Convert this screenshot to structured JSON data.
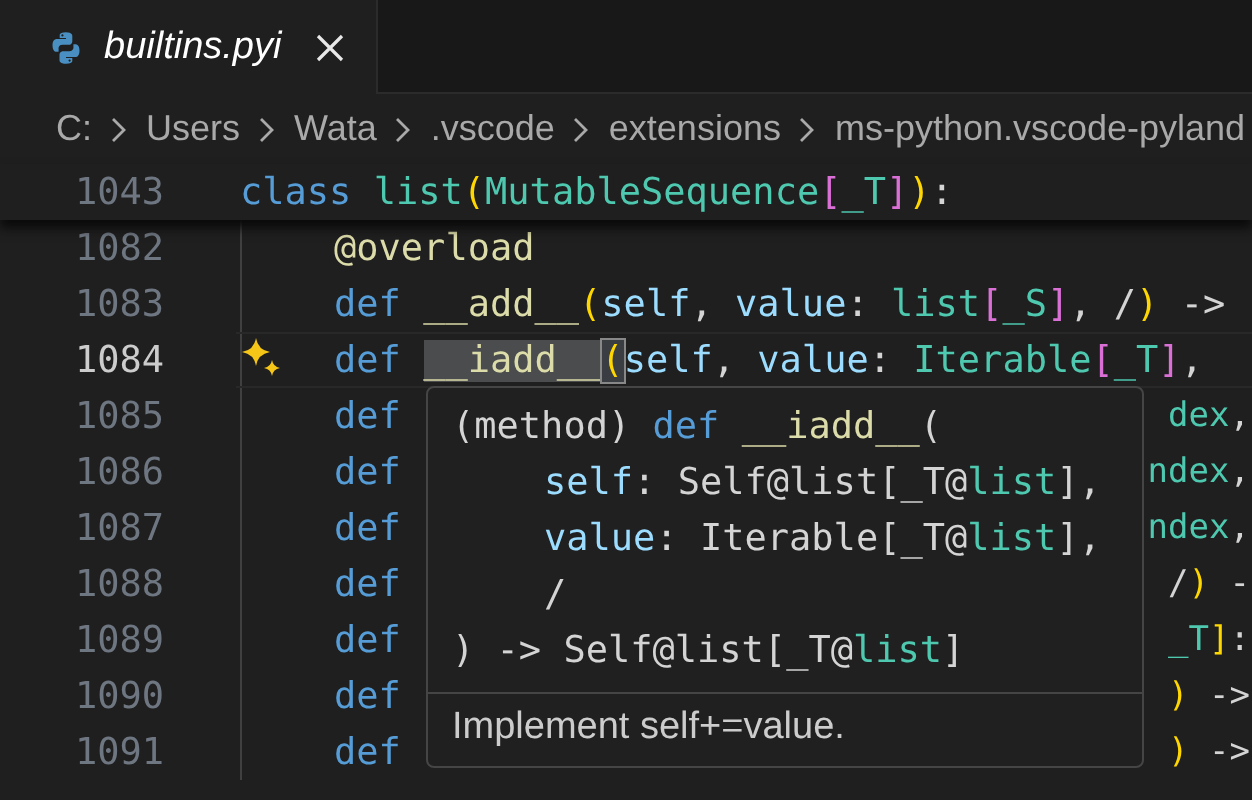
{
  "tab": {
    "title": "builtins.pyi",
    "preview": true
  },
  "breadcrumbs": [
    "C:",
    "Users",
    "Wata",
    ".vscode",
    "extensions",
    "ms-python.vscode-pyland"
  ],
  "sticky": {
    "number": "1043",
    "tokens": [
      {
        "t": "class ",
        "kind": "kw"
      },
      {
        "t": "list",
        "kind": "type"
      },
      {
        "t": "(",
        "kind": "br1"
      },
      {
        "t": "MutableSequence",
        "kind": "type"
      },
      {
        "t": "[",
        "kind": "br2"
      },
      {
        "t": "_T",
        "kind": "type"
      },
      {
        "t": "]",
        "kind": "br2"
      },
      {
        "t": ")",
        "kind": "br1"
      },
      {
        "t": ":",
        "kind": "plain"
      }
    ],
    "children": [
      {
        "number": "1082",
        "active": false,
        "tokens": [
          {
            "t": "@overload",
            "kind": "fn"
          }
        ]
      },
      {
        "number": "1083",
        "active": false,
        "tokens": [
          {
            "t": "def ",
            "kind": "kw"
          },
          {
            "t": "__add__",
            "kind": "fn"
          },
          {
            "t": "(",
            "kind": "br1"
          },
          {
            "t": "self",
            "kind": "param"
          },
          {
            "t": ", ",
            "kind": "plain"
          },
          {
            "t": "value",
            "kind": "param"
          },
          {
            "t": ": ",
            "kind": "plain"
          },
          {
            "t": "list",
            "kind": "type"
          },
          {
            "t": "[",
            "kind": "br2"
          },
          {
            "t": "_S",
            "kind": "type"
          },
          {
            "t": "]",
            "kind": "br2"
          },
          {
            "t": ", /",
            "kind": "plain"
          },
          {
            "t": ")",
            "kind": "br1"
          },
          {
            "t": " ->",
            "kind": "plain"
          }
        ]
      },
      {
        "number": "1084",
        "active": true,
        "tokens": [
          {
            "t": "def ",
            "kind": "kw"
          },
          {
            "t": "__iadd__",
            "kind": "fn_hl"
          },
          {
            "t": "(",
            "kind": "br1_match"
          },
          {
            "t": "self",
            "kind": "param"
          },
          {
            "t": ", ",
            "kind": "plain"
          },
          {
            "t": "value",
            "kind": "param"
          },
          {
            "t": ": ",
            "kind": "plain"
          },
          {
            "t": "Iterable",
            "kind": "type"
          },
          {
            "t": "[",
            "kind": "br2"
          },
          {
            "t": "_T",
            "kind": "type"
          },
          {
            "t": "]",
            "kind": "br2"
          },
          {
            "t": ",",
            "kind": "plain"
          }
        ]
      },
      {
        "number": "1085",
        "active": false,
        "tokens": [
          {
            "t": "def",
            "kind": "kw"
          }
        ],
        "tail": [
          {
            "t": "dex",
            "kind": "type"
          },
          {
            "t": ",",
            "kind": "plain"
          }
        ]
      },
      {
        "number": "1086",
        "active": false,
        "tokens": [
          {
            "t": "def",
            "kind": "kw"
          }
        ],
        "tail": [
          {
            "t": "ndex",
            "kind": "type"
          },
          {
            "t": ",",
            "kind": "plain"
          }
        ]
      },
      {
        "number": "1087",
        "active": false,
        "tokens": [
          {
            "t": "def",
            "kind": "kw"
          }
        ],
        "tail": [
          {
            "t": "ndex",
            "kind": "type"
          },
          {
            "t": ",",
            "kind": "plain"
          }
        ]
      },
      {
        "number": "1088",
        "active": false,
        "tokens": [
          {
            "t": "def",
            "kind": "kw"
          }
        ],
        "tail": [
          {
            "t": "/",
            "kind": "plain"
          },
          {
            "t": ")",
            "kind": "br1"
          },
          {
            "t": " -",
            "kind": "plain"
          }
        ]
      },
      {
        "number": "1089",
        "active": false,
        "tokens": [
          {
            "t": "def",
            "kind": "kw"
          }
        ],
        "tail": [
          {
            "t": "_T",
            "kind": "type"
          },
          {
            "t": "]",
            "kind": "br1"
          },
          {
            "t": ":",
            "kind": "plain"
          }
        ]
      },
      {
        "number": "1090",
        "active": false,
        "tokens": [
          {
            "t": "def",
            "kind": "kw"
          }
        ],
        "tail": [
          {
            "t": ")",
            "kind": "br1"
          },
          {
            "t": " ->",
            "kind": "plain"
          }
        ]
      },
      {
        "number": "1091",
        "active": false,
        "tokens": [
          {
            "t": "def",
            "kind": "kw"
          }
        ],
        "tail": [
          {
            "t": ")",
            "kind": "br1"
          },
          {
            "t": " ->",
            "kind": "plain"
          }
        ]
      }
    ]
  },
  "hover": {
    "signature": [
      {
        "indent": false,
        "tokens": [
          {
            "t": "(method) ",
            "kind": "plain"
          },
          {
            "t": "def ",
            "kind": "kw"
          },
          {
            "t": "__iadd__",
            "kind": "fn"
          },
          {
            "t": "(",
            "kind": "plain"
          }
        ]
      },
      {
        "indent": true,
        "tokens": [
          {
            "t": "self",
            "kind": "param"
          },
          {
            "t": ": Self@list[_T@",
            "kind": "plain"
          },
          {
            "t": "list",
            "kind": "type"
          },
          {
            "t": "],",
            "kind": "plain"
          }
        ]
      },
      {
        "indent": true,
        "tokens": [
          {
            "t": "value",
            "kind": "param"
          },
          {
            "t": ": Iterable[_T@",
            "kind": "plain"
          },
          {
            "t": "list",
            "kind": "type"
          },
          {
            "t": "],",
            "kind": "plain"
          }
        ]
      },
      {
        "indent": true,
        "tokens": [
          {
            "t": "/",
            "kind": "plain"
          }
        ]
      },
      {
        "indent": false,
        "tokens": [
          {
            "t": ") -> Self@list[_T@",
            "kind": "plain"
          },
          {
            "t": "list",
            "kind": "type"
          },
          {
            "t": "]",
            "kind": "plain"
          }
        ]
      }
    ],
    "doc": "Implement self+=value."
  }
}
